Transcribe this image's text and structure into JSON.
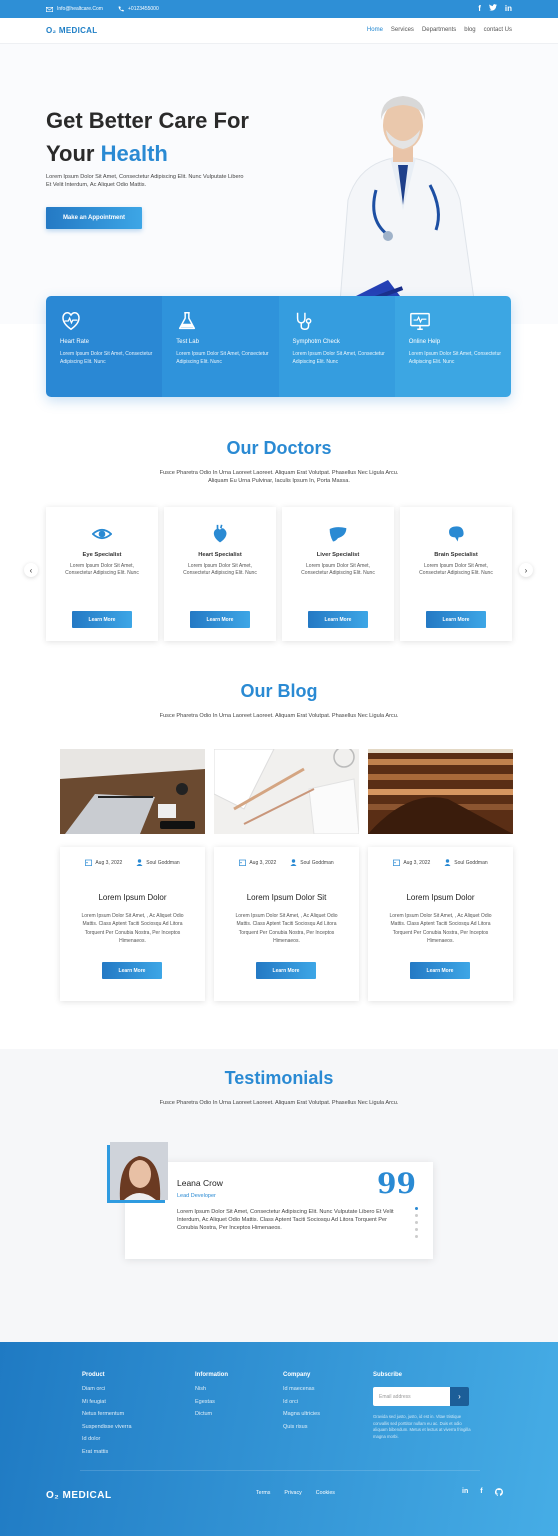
{
  "topbar": {
    "email": "Info@healtcare.Com",
    "phone": "+0123455000",
    "social": [
      "f",
      "t",
      "in"
    ]
  },
  "nav": {
    "logo": "O₂ MEDICAL",
    "items": [
      "Home",
      "Services",
      "Departments",
      "blog",
      "contact Us"
    ]
  },
  "hero": {
    "title_line1": "Get Better Care For",
    "title_line2_prefix": "Your ",
    "title_line2_highlight": "Health",
    "subtitle": "Lorem Ipsum Dolor Sit Amet, Consectetur Adipiscing Elit. Nunc Vulputate Libero Et Velit Interdum, Ac Aliquet Odio Mattis.",
    "cta": "Make an Appointment"
  },
  "features": [
    {
      "title": "Heart Rate",
      "desc": "Lorem Ipsum Dolor Sit Amet, Consectetur Adipiscing Elit. Nunc",
      "icon": "heart-pulse-icon",
      "color": "#2a88d4"
    },
    {
      "title": "Test Lab",
      "desc": "Lorem Ipsum Dolor Sit Amet, Consectetur Adipiscing Elit. Nunc",
      "icon": "flask-icon",
      "color": "#2f93db"
    },
    {
      "title": "Symphotm Check",
      "desc": "Lorem Ipsum Dolor Sit Amet, Consectetur Adipiscing Elit. Nunc",
      "icon": "stethoscope-icon",
      "color": "#359ddf"
    },
    {
      "title": "Online Help",
      "desc": "Lorem Ipsum Dolor Sit Amet, Consectetur Adipiscing Elit. Nunc",
      "icon": "monitor-icon",
      "color": "#3ca6e3"
    }
  ],
  "doctors": {
    "title": "Our Doctors",
    "subtitle": "Fusce Pharetra Odio In Urna Laoreet Laoreet. Aliquam Erat Volutpat. Phasellus Nec Ligula Arcu. Aliquam Eu Urna Pulvinar, Iaculis Ipsum In, Porta Massa.",
    "button": "Learn More",
    "cards": [
      {
        "title": "Eye Specialist",
        "desc": "Lorem Ipsum Dolor Sit Amet, Consectetur Adipiscing Elit. Nunc",
        "icon": "eye-icon"
      },
      {
        "title": "Heart Specialist",
        "desc": "Lorem Ipsum Dolor Sit Amet, Consectetur Adipiscing Elit. Nunc",
        "icon": "heart-organ-icon"
      },
      {
        "title": "Liver Specialist",
        "desc": "Lorem Ipsum Dolor Sit Amet, Consectetur Adipiscing Elit. Nunc",
        "icon": "liver-icon"
      },
      {
        "title": "Brain Specialist",
        "desc": "Lorem Ipsum Dolor Sit Amet, Consectetur Adipiscing Elit. Nunc",
        "icon": "brain-icon"
      }
    ]
  },
  "blog": {
    "title": "Our Blog",
    "subtitle": "Fusce Pharetra Odio In Urna Laoreet Laoreet. Aliquam Erat Volutpat. Phasellus Nec Ligula Arcu.",
    "button": "Learn More",
    "posts": [
      {
        "date": "Aug 3, 2022",
        "author": "Soul Goddman",
        "title": "Lorem Ipsum Dolor",
        "desc": "Lorem Ipsum Dolor Sit Amet, , Ac Aliquet Odio Mattis. Class Aptent Taciti Sociosqu Ad Litora Torquent Per Conubia Nostra, Per Inceptos Himenaeos."
      },
      {
        "date": "Aug 3, 2022",
        "author": "Soul Goddman",
        "title": "Lorem Ipsum Dolor Sit",
        "desc": "Lorem Ipsum Dolor Sit Amet, , Ac Aliquet Odio Mattis. Class Aptent Taciti Sociosqu Ad Litora Torquent Per Conubia Nostra, Per Inceptos Himenaeos."
      },
      {
        "date": "Aug 3, 2022",
        "author": "Soul Goddman",
        "title": "Lorem Ipsum Dolor",
        "desc": "Lorem Ipsum Dolor Sit Amet, , Ac Aliquet Odio Mattis. Class Aptent Taciti Sociosqu Ad Litora Torquent Per Conubia Nostra, Per Inceptos Himenaeos."
      }
    ]
  },
  "testimonials": {
    "title": "Testimonials",
    "subtitle": "Fusce Pharetra Odio In Urna Laoreet Laoreet. Aliquam Erat Volutpat. Phasellus Nec Ligula Arcu.",
    "name": "Leana Crow",
    "role": "Lead Developer",
    "quote": "Lorem Ipsum Dolor Sit Amet, Consectetur Adipiscing Elit. Nunc Vulputate Libero Et Velit Interdum, Ac Aliquet Odio Mattis. Class Aptent Taciti Sociosqu Ad Litora Torquent Per Conubia Nostra, Per Inceptos Himenaeos.",
    "quote_mark": "99"
  },
  "footer": {
    "columns": [
      {
        "heading": "Product",
        "links": [
          "Diam orci",
          "Mi feugiat",
          "Netus fermentum",
          "Suspendisse viverra",
          "Id dolor",
          "Erat mattis"
        ]
      },
      {
        "heading": "Information",
        "links": [
          "Nish",
          "Egestas",
          "Dictum"
        ]
      },
      {
        "heading": "Company",
        "links": [
          "Id maecenas",
          "Id orci",
          "Magna ultricies",
          "Quis risus"
        ]
      }
    ],
    "subscribe": {
      "heading": "Subscribe",
      "placeholder": "Email address",
      "text": "Gravida sed justo, justo, id est in. Vitae tristique convallis sed porttitor nullam eu ac. Duis et odio aliquam bibendum. Metus et lectus at viverra fringilla magna morbi."
    },
    "logo": "O₂ MEDICAL",
    "links": [
      "Terms",
      "Privacy",
      "Cookies"
    ],
    "social": [
      "in",
      "f",
      "gh"
    ]
  }
}
